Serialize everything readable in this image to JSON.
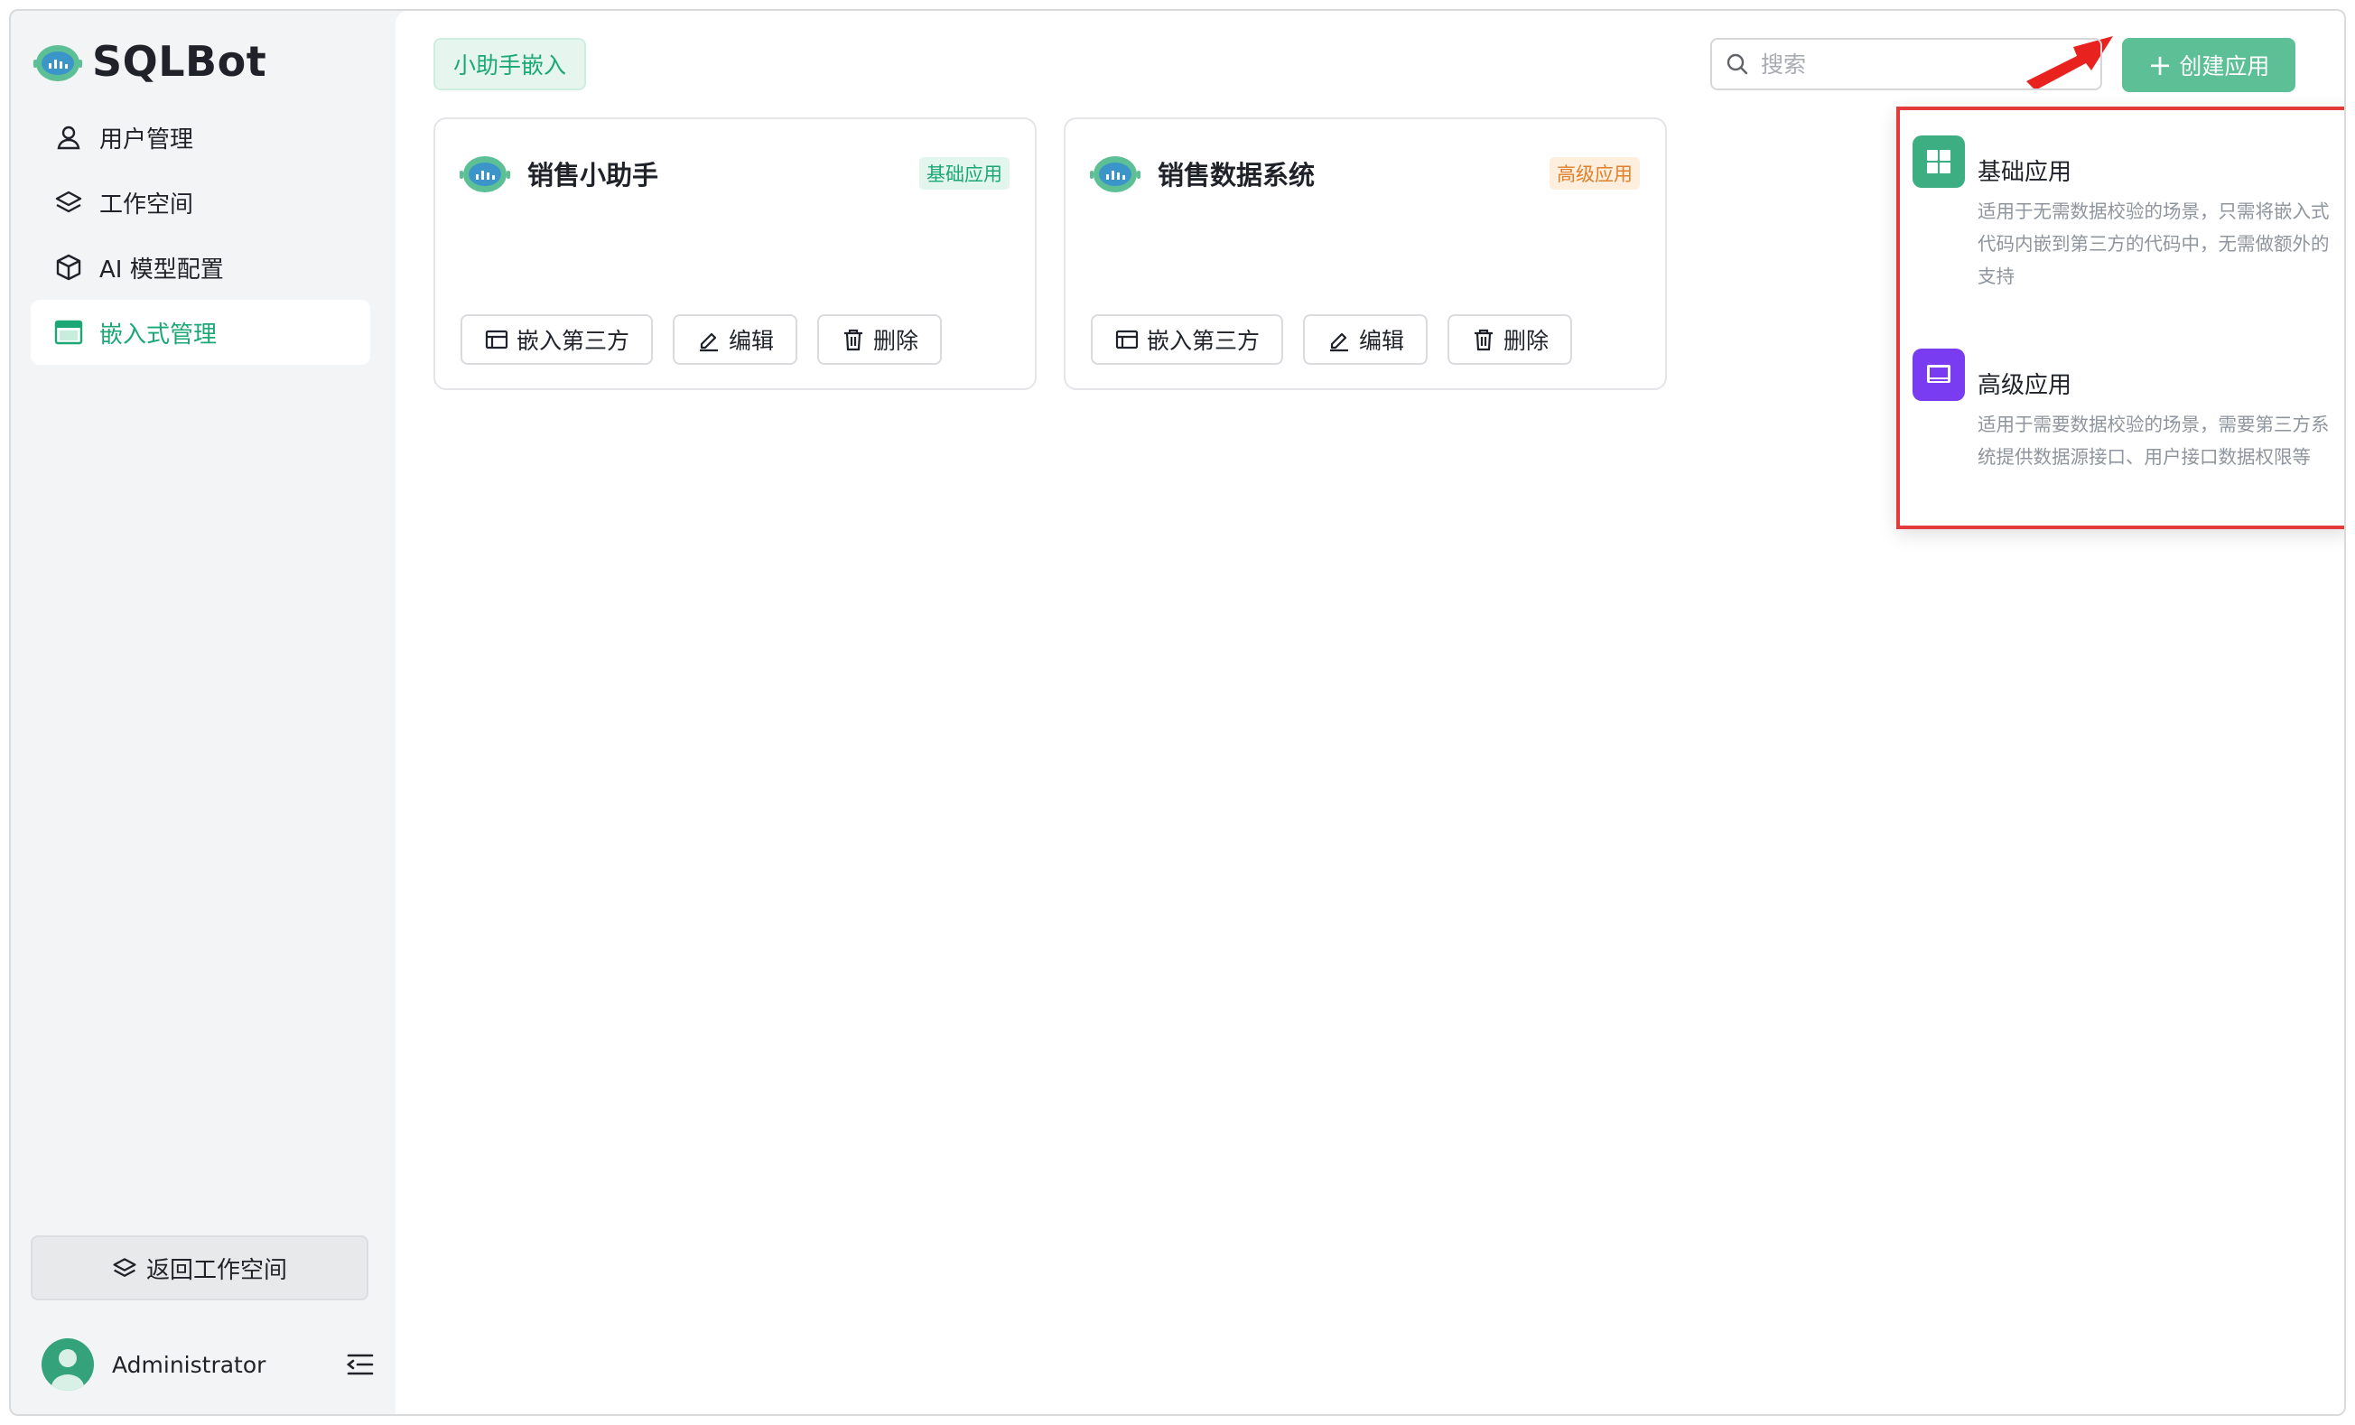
{
  "app": {
    "name": "SQLBot"
  },
  "sidebar": {
    "items": [
      {
        "label": "用户管理",
        "icon": "user-icon",
        "active": false
      },
      {
        "label": "工作空间",
        "icon": "layers-icon",
        "active": false
      },
      {
        "label": "AI 模型配置",
        "icon": "cube-icon",
        "active": false
      },
      {
        "label": "嵌入式管理",
        "icon": "embed-window-icon",
        "active": true
      }
    ],
    "back_label": "返回工作空间",
    "user_name": "Administrator"
  },
  "main": {
    "tab_label": "小助手嵌入",
    "search_placeholder": "搜索",
    "create_label": "创建应用",
    "cards": [
      {
        "title": "销售小助手",
        "badge": "基础应用",
        "actions": {
          "embed": "嵌入第三方",
          "edit": "编辑",
          "delete": "删除"
        }
      },
      {
        "title": "销售数据系统",
        "badge": "高级应用",
        "actions": {
          "embed": "嵌入第三方",
          "edit": "编辑",
          "delete": "删除"
        }
      }
    ]
  },
  "dropdown": {
    "basic": {
      "title": "基础应用",
      "desc": "适用于无需数据校验的场景，只需将嵌入式代码内嵌到第三方的代码中，无需做额外的支持"
    },
    "advanced": {
      "title": "高级应用",
      "desc": "适用于需要数据校验的场景，需要第三方系统提供数据源接口、用户接口数据权限等"
    }
  },
  "colors": {
    "accent": "#1ca776",
    "button": "#5cbf95",
    "advanced_icon": "#7a3cf0",
    "highlight": "#e53a3a"
  }
}
